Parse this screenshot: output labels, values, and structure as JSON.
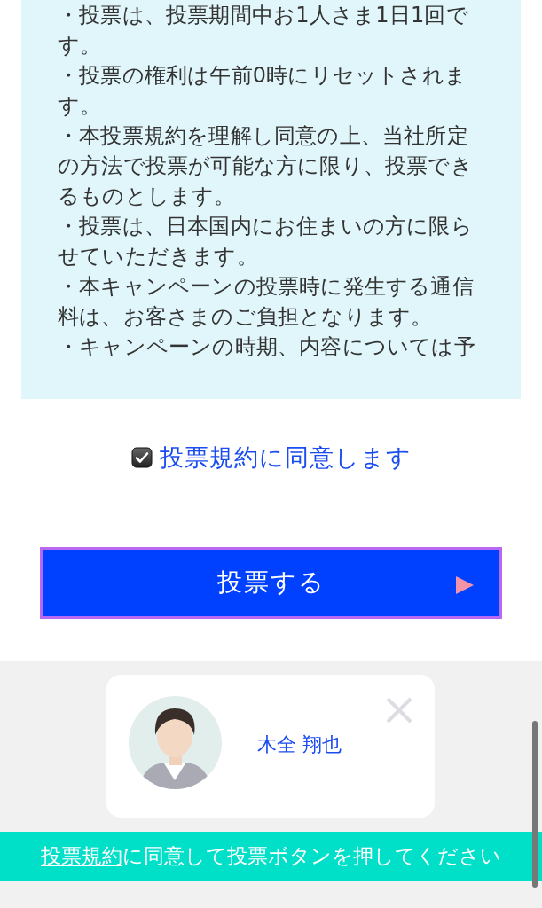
{
  "terms": {
    "items": [
      "・投票は、投票期間中お1人さま1日1回です。",
      "・投票の権利は午前0時にリセットされます。",
      "・本投票規約を理解し同意の上、当社所定の方法で投票が可能な方に限り、投票できるものとします。",
      "・投票は、日本国内にお住まいの方に限らせていただきます。",
      "・本キャンペーンの投票時に発生する通信料は、お客さまのご負担となります。",
      "・キャンペーンの時期、内容については予"
    ]
  },
  "agreement": {
    "label": "投票規約に同意します",
    "checked": true
  },
  "vote_button": {
    "label": "投票する"
  },
  "candidate_card": {
    "name": "木全 翔也"
  },
  "notice_bar": {
    "link": "投票規約",
    "text": "に同意して投票ボタンを押してください"
  }
}
